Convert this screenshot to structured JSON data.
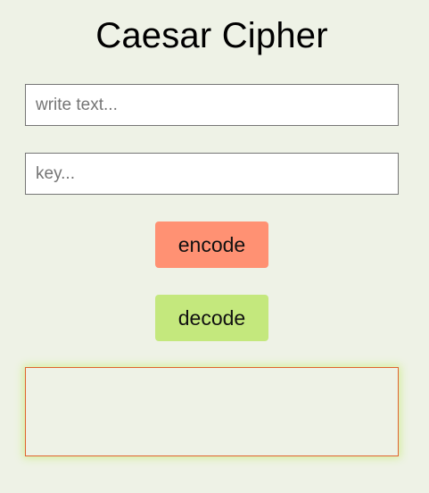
{
  "app": {
    "title": "Caesar Cipher"
  },
  "inputs": {
    "text": {
      "value": "",
      "placeholder": "write text..."
    },
    "key": {
      "value": "",
      "placeholder": "key..."
    }
  },
  "buttons": {
    "encode_label": "encode",
    "decode_label": "decode"
  },
  "output": {
    "value": ""
  },
  "colors": {
    "background": "#eef2e6",
    "encode_button": "#ff9173",
    "decode_button": "#c4e87d",
    "output_border": "#e0632e",
    "output_glow": "#d5ee9e"
  }
}
